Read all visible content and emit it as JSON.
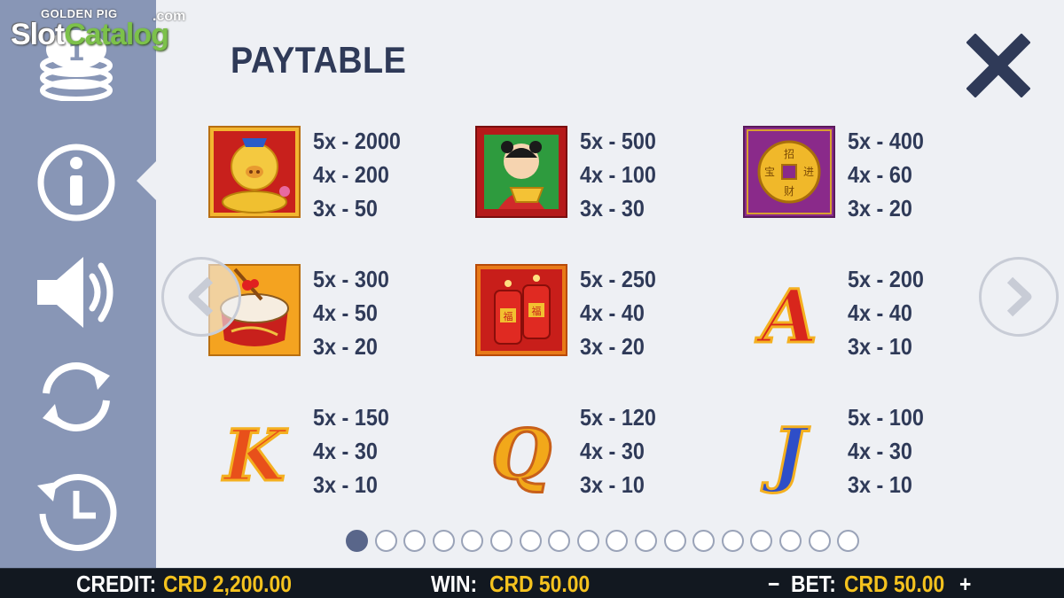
{
  "logo": {
    "top": "GOLDEN PIG",
    "slot": "Slot",
    "catalog": "Catalog",
    "dotcom": ".com"
  },
  "title": "PAYTABLE",
  "sidebar": {
    "buttons": [
      {
        "icon": "coins-icon"
      },
      {
        "icon": "info-icon",
        "active": true
      },
      {
        "icon": "speaker-icon"
      },
      {
        "icon": "refresh-icon"
      },
      {
        "icon": "history-icon"
      }
    ]
  },
  "paytable": [
    {
      "symbol": "golden-pig",
      "pays": [
        "5x - 2000",
        "4x - 200",
        "3x - 50"
      ]
    },
    {
      "symbol": "child-with-gold",
      "pays": [
        "5x - 500",
        "4x - 100",
        "3x - 30"
      ]
    },
    {
      "symbol": "chinese-coin",
      "pays": [
        "5x - 400",
        "4x - 60",
        "3x - 20"
      ]
    },
    {
      "symbol": "drum",
      "pays": [
        "5x - 300",
        "4x - 50",
        "3x - 20"
      ]
    },
    {
      "symbol": "firecrackers",
      "pays": [
        "5x - 250",
        "4x - 40",
        "3x - 20"
      ]
    },
    {
      "symbol": "A",
      "pays": [
        "5x - 200",
        "4x - 40",
        "3x - 10"
      ]
    },
    {
      "symbol": "K",
      "pays": [
        "5x - 150",
        "4x - 30",
        "3x - 10"
      ]
    },
    {
      "symbol": "Q",
      "pays": [
        "5x - 120",
        "4x - 30",
        "3x - 10"
      ]
    },
    {
      "symbol": "J",
      "pays": [
        "5x - 100",
        "4x - 30",
        "3x - 10"
      ]
    }
  ],
  "coin_chars": [
    "招",
    "进",
    "宝",
    "财"
  ],
  "firecracker_char": "福",
  "pagination": {
    "total": 18,
    "current": 1
  },
  "bottom": {
    "credit_label": "CREDIT:",
    "credit_value": "CRD 2,200.00",
    "win_label": "WIN:",
    "win_value": "CRD 50.00",
    "bet_minus": "−",
    "bet_label": "BET:",
    "bet_value": "CRD 50.00",
    "bet_plus": "+"
  },
  "colors": {
    "sidebar": "#8896b6",
    "background": "#eef0f4",
    "text": "#2f3a58",
    "accent_yellow": "#f4c21e"
  }
}
